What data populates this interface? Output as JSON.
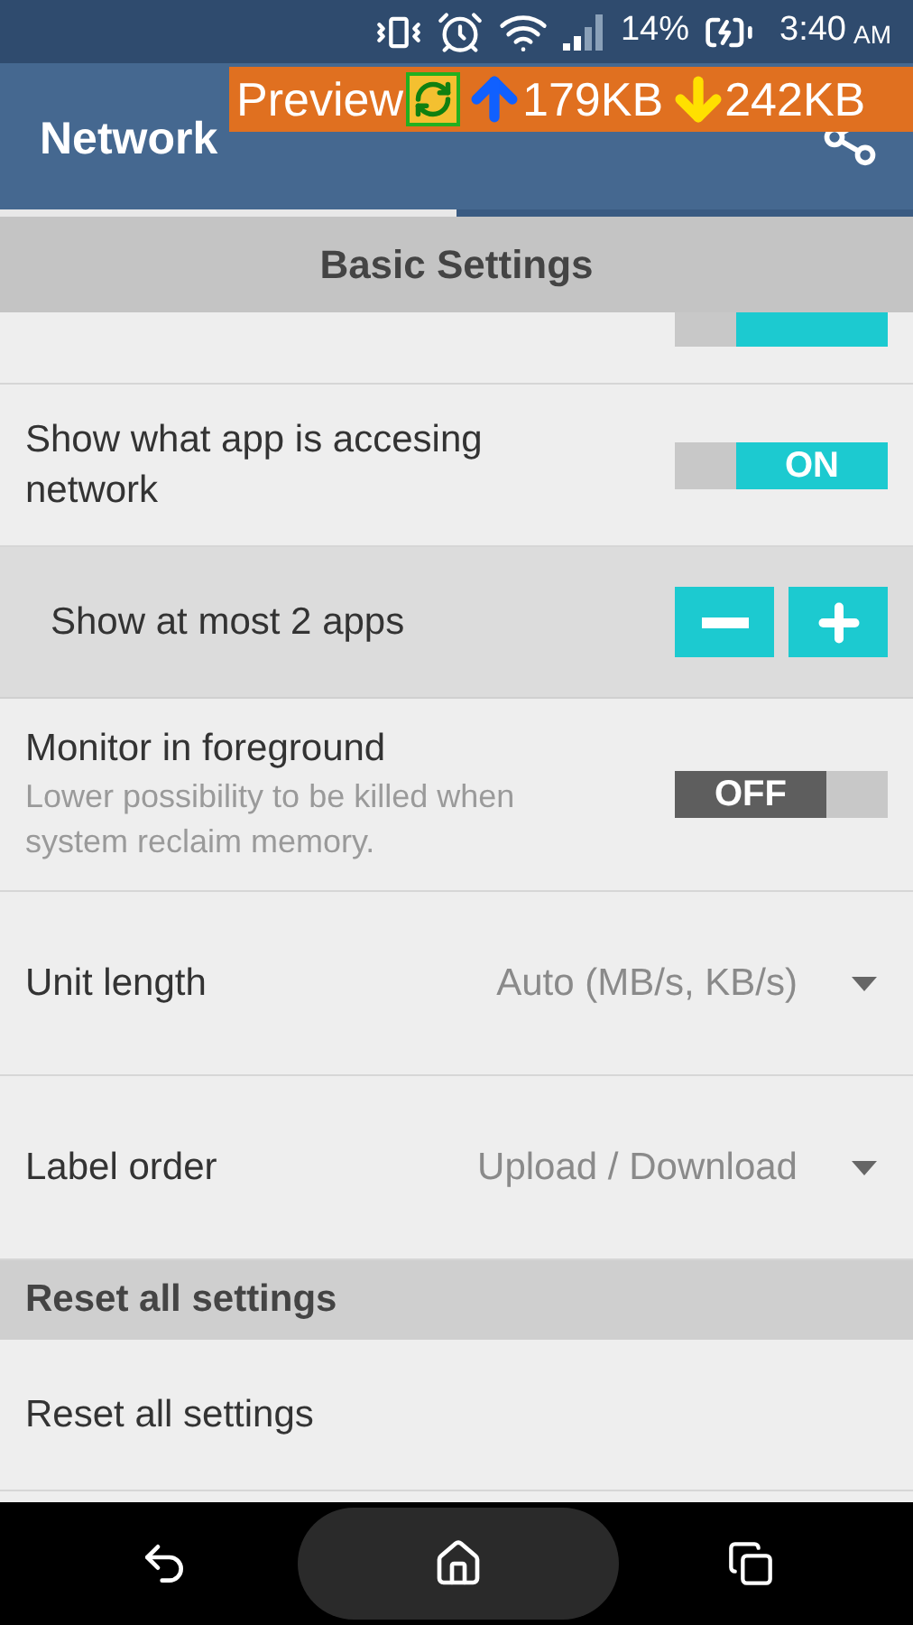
{
  "status_bar": {
    "battery": "14%",
    "time": "3:40",
    "meridiem": "AM"
  },
  "overlay": {
    "label": "Preview",
    "upload": "179KB",
    "download": "242KB"
  },
  "app_bar": {
    "title": "Network"
  },
  "tabs": [
    {
      "selected": true
    },
    {
      "selected": false
    }
  ],
  "sections": [
    {
      "header": "Basic Settings",
      "items": [
        {
          "kind": "partial_toggle",
          "on": true
        },
        {
          "kind": "toggle",
          "label": "Show what app is accesing network",
          "on": true,
          "state_text": "ON"
        },
        {
          "kind": "stepper",
          "label": "Show at most 2 apps"
        },
        {
          "kind": "toggle",
          "label": "Monitor in foreground",
          "summary": "Lower possibility to be killed when system reclaim memory.",
          "on": false,
          "state_text": "OFF"
        },
        {
          "kind": "dropdown",
          "label": "Unit length",
          "value": "Auto (MB/s, KB/s)"
        },
        {
          "kind": "dropdown",
          "label": "Label order",
          "value": "Upload / Download"
        }
      ]
    },
    {
      "header": "Reset all settings",
      "items": [
        {
          "kind": "action",
          "label": "Reset all settings"
        }
      ]
    }
  ]
}
